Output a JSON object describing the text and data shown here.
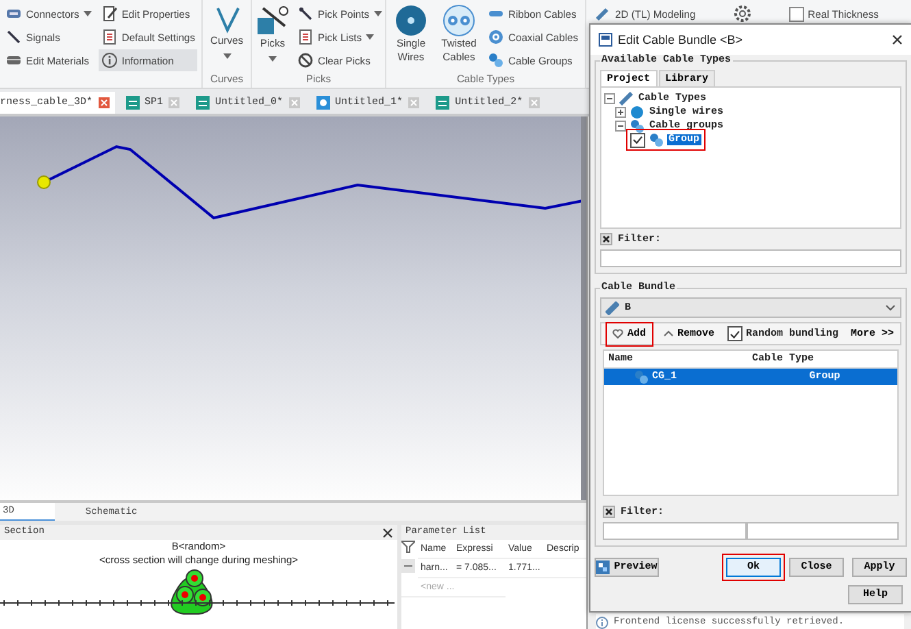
{
  "ribbon": {
    "groups": [
      {
        "columns": [
          [
            {
              "label": "Connectors",
              "dropdown": true,
              "highlighted": false
            },
            {
              "label": "Signals",
              "dropdown": false,
              "highlighted": false
            },
            {
              "label": "Edit Materials",
              "dropdown": false,
              "highlighted": false
            }
          ],
          [
            {
              "label": "Edit Properties",
              "dropdown": false,
              "highlighted": false
            },
            {
              "label": "Default Settings",
              "dropdown": false,
              "highlighted": false
            },
            {
              "label": "Information",
              "dropdown": false,
              "highlighted": true
            }
          ]
        ]
      },
      {
        "label": "Curves",
        "large": [
          {
            "label": "Curves",
            "dropdown": true
          }
        ]
      },
      {
        "label": "Picks",
        "large": [
          {
            "label": "Picks",
            "dropdown": true
          }
        ],
        "columns": [
          [
            {
              "label": "Pick Points",
              "dropdown": true,
              "highlighted": false
            },
            {
              "label": "Pick Lists",
              "dropdown": true,
              "highlighted": false
            },
            {
              "label": "Clear Picks",
              "dropdown": false,
              "highlighted": false
            }
          ]
        ]
      },
      {
        "label": "Cable Types",
        "large": [
          {
            "label": "Single Wires",
            "dropdown": false
          },
          {
            "label": "Twisted Cables",
            "dropdown": false
          }
        ],
        "columns": [
          [
            {
              "label": "Ribbon Cables",
              "dropdown": false,
              "highlighted": false
            },
            {
              "label": "Coaxial Cables",
              "dropdown": false,
              "highlighted": false
            },
            {
              "label": "Cable Groups",
              "dropdown": false,
              "highlighted": false
            }
          ]
        ]
      }
    ],
    "extra": {
      "modeling": "2D (TL) Modeling",
      "thickness": {
        "label": "Real Thickness",
        "checked": false
      }
    }
  },
  "doc_tabs": [
    {
      "label": "rness_cable_3D*",
      "selected": true
    },
    {
      "label": "SP1",
      "kind": "schematic",
      "selected": false
    },
    {
      "label": "Untitled_0*",
      "kind": "schematic",
      "selected": false
    },
    {
      "label": "Untitled_1*",
      "kind": "model",
      "selected": false
    },
    {
      "label": "Untitled_2*",
      "kind": "schematic",
      "selected": false
    }
  ],
  "view_tabs": [
    {
      "label": "3D",
      "selected": true
    },
    {
      "label": "Schematic",
      "selected": false
    }
  ],
  "section_panel": {
    "title": "Section",
    "bundle_label": "B<random>",
    "note": "<cross section will change during meshing>"
  },
  "parameter_list": {
    "title": "Parameter List",
    "columns": [
      "Name",
      "Expressi",
      "Value",
      "Descrip"
    ],
    "rows": [
      [
        "harn...",
        "= 7.085...",
        "1.771..."
      ]
    ],
    "new_row": {
      "placeholder": "<new ..."
    }
  },
  "dialog": {
    "title": "Edit Cable Bundle <B>",
    "available": {
      "title": "Available Cable Types",
      "tabs": [
        {
          "label": "Project",
          "selected": true
        },
        {
          "label": "Library",
          "selected": false
        }
      ],
      "tree": [
        {
          "label": "Cable Types",
          "kind": "root",
          "expanded": true,
          "children": [
            {
              "label": "Single wires",
              "kind": "wire",
              "expanded": false
            },
            {
              "label": "Cable groups",
              "kind": "group",
              "expanded": true,
              "children": [
                {
                  "label": "Group",
                  "kind": "group",
                  "checked": true,
                  "selected": true,
                  "highlighted": true
                }
              ]
            }
          ]
        }
      ],
      "filter_label": "Filter:"
    },
    "bundle": {
      "title": "Cable Bundle",
      "selection": "B",
      "add": {
        "label": "Add",
        "highlighted": true
      },
      "remove": "Remove",
      "random": {
        "label": "Random bundling",
        "checked": true
      },
      "more": "More >>",
      "columns": [
        "Name",
        "Cable Type"
      ],
      "rows": [
        {
          "name": "CG_1",
          "type": "Group",
          "selected": true
        }
      ],
      "filter_label": "Filter:"
    },
    "buttons": [
      {
        "label": "Preview",
        "default": false,
        "highlighted": false
      },
      {
        "label": "Ok",
        "default": true,
        "highlighted": true
      },
      {
        "label": "Close",
        "default": false,
        "highlighted": false
      },
      {
        "label": "Apply",
        "default": false,
        "highlighted": false
      },
      {
        "label": "Help",
        "default": false,
        "highlighted": false
      }
    ]
  },
  "status_message": "Frontend license successfully retrieved."
}
